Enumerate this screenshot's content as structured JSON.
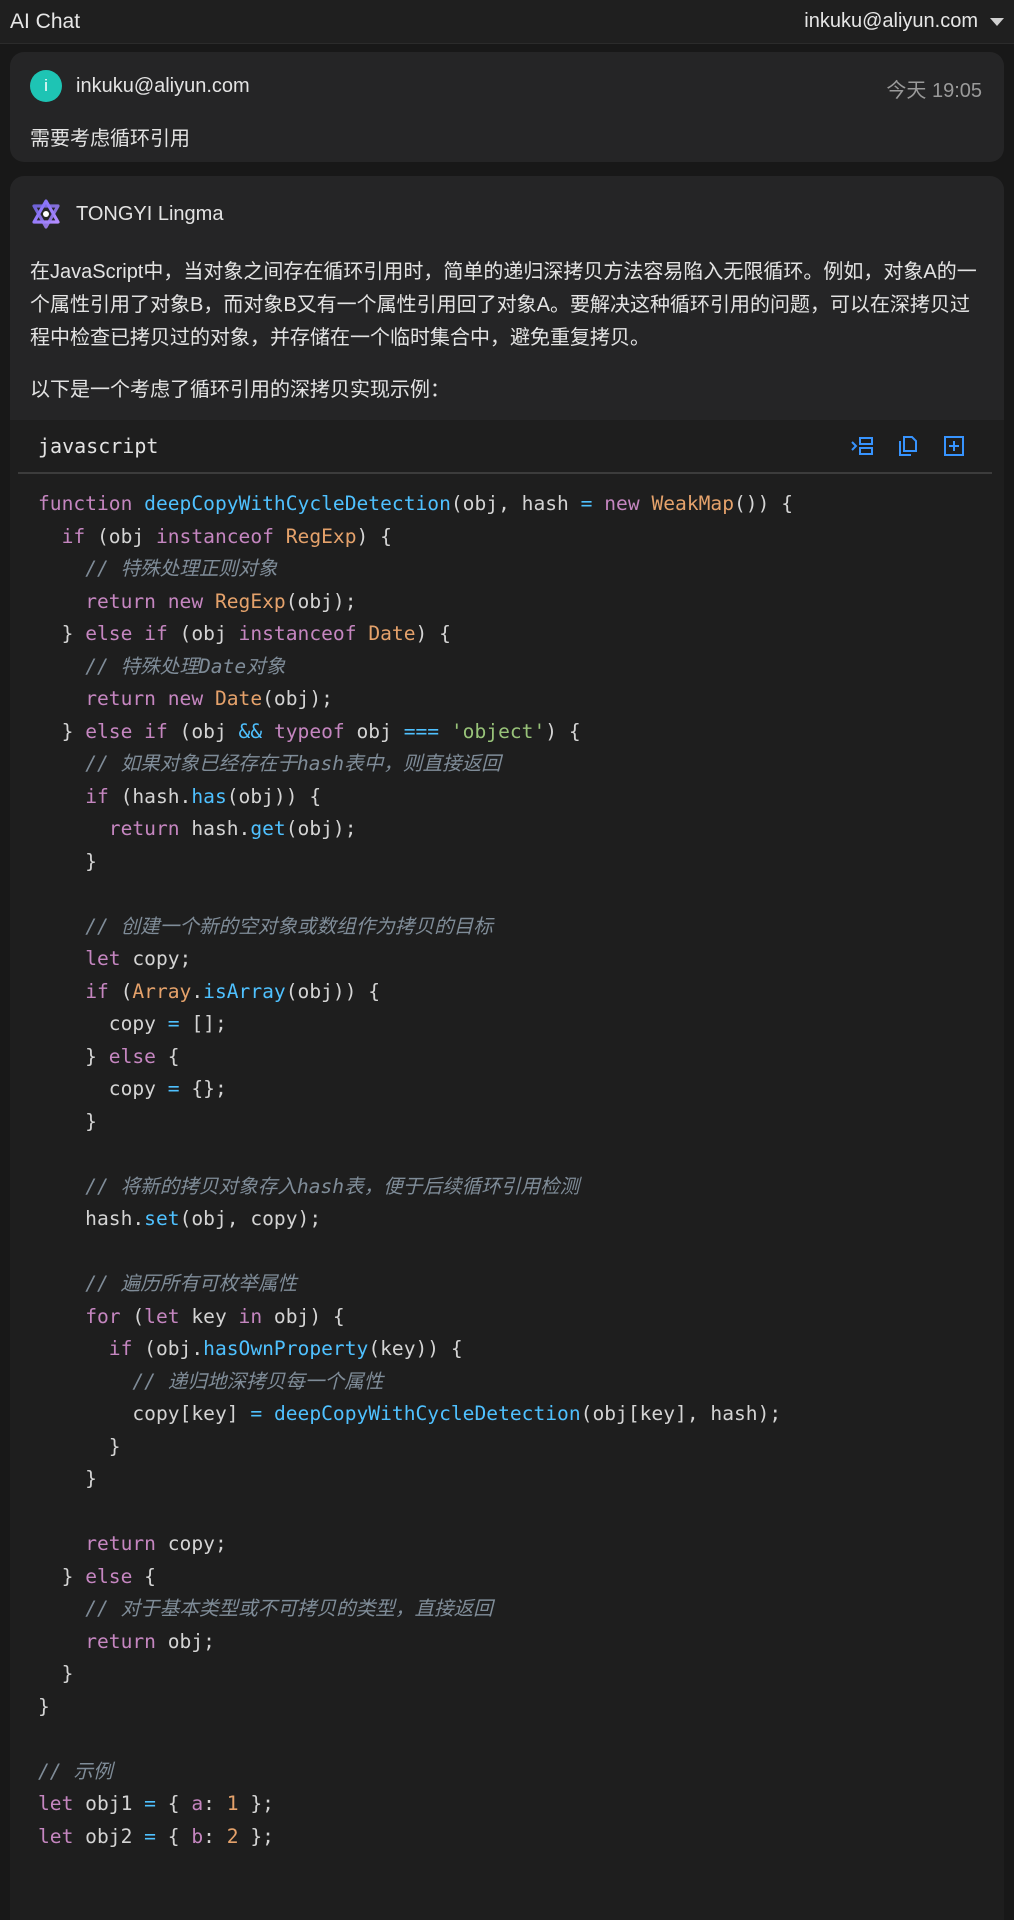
{
  "header": {
    "title": "AI Chat",
    "account": "inkuku@aliyun.com"
  },
  "user_message": {
    "avatar_letter": "i",
    "name": "inkuku@aliyun.com",
    "time": "今天 19:05",
    "text": "需要考虑循环引用"
  },
  "assistant_message": {
    "name": "TONGYI Lingma",
    "paragraph1": "在JavaScript中，当对象之间存在循环引用时，简单的递归深拷贝方法容易陷入无限循环。例如，对象A的一个属性引用了对象B，而对象B又有一个属性引用回了对象A。要解决这种循环引用的问题，可以在深拷贝过程中检查已拷贝过的对象，并存储在一个临时集合中，避免重复拷贝。",
    "paragraph2": "以下是一个考虑了循环引用的深拷贝实现示例：",
    "code_language": "javascript",
    "code_actions": [
      {
        "name": "insert-icon"
      },
      {
        "name": "copy-icon"
      },
      {
        "name": "new-file-icon"
      }
    ],
    "code_lines": [
      [
        [
          "k",
          "function "
        ],
        [
          "f",
          "deepCopyWithCycleDetection"
        ],
        [
          "p",
          "(obj, hash "
        ],
        [
          "f",
          "="
        ],
        [
          "p",
          " "
        ],
        [
          "k",
          "new "
        ],
        [
          "t",
          "WeakMap"
        ],
        [
          "p",
          "()) {"
        ]
      ],
      [
        [
          "p",
          "  "
        ],
        [
          "k",
          "if"
        ],
        [
          "p",
          " (obj "
        ],
        [
          "k",
          "instanceof "
        ],
        [
          "t",
          "RegExp"
        ],
        [
          "p",
          ") {"
        ]
      ],
      [
        [
          "p",
          "    "
        ],
        [
          "c",
          "// 特殊处理正则对象"
        ]
      ],
      [
        [
          "p",
          "    "
        ],
        [
          "k",
          "return "
        ],
        [
          "k",
          "new "
        ],
        [
          "t",
          "RegExp"
        ],
        [
          "p",
          "(obj);"
        ]
      ],
      [
        [
          "p",
          "  } "
        ],
        [
          "k",
          "else if"
        ],
        [
          "p",
          " (obj "
        ],
        [
          "k",
          "instanceof "
        ],
        [
          "t",
          "Date"
        ],
        [
          "p",
          ") {"
        ]
      ],
      [
        [
          "p",
          "    "
        ],
        [
          "c",
          "// 特殊处理Date对象"
        ]
      ],
      [
        [
          "p",
          "    "
        ],
        [
          "k",
          "return "
        ],
        [
          "k",
          "new "
        ],
        [
          "t",
          "Date"
        ],
        [
          "p",
          "(obj);"
        ]
      ],
      [
        [
          "p",
          "  } "
        ],
        [
          "k",
          "else if"
        ],
        [
          "p",
          " (obj "
        ],
        [
          "f",
          "&&"
        ],
        [
          "p",
          " "
        ],
        [
          "k",
          "typeof"
        ],
        [
          "p",
          " obj "
        ],
        [
          "f",
          "==="
        ],
        [
          "p",
          " "
        ],
        [
          "s",
          "'object'"
        ],
        [
          "p",
          ") {"
        ]
      ],
      [
        [
          "p",
          "    "
        ],
        [
          "c",
          "// 如果对象已经存在于hash表中，则直接返回"
        ]
      ],
      [
        [
          "p",
          "    "
        ],
        [
          "k",
          "if"
        ],
        [
          "p",
          " (hash."
        ],
        [
          "f",
          "has"
        ],
        [
          "p",
          "(obj)) {"
        ]
      ],
      [
        [
          "p",
          "      "
        ],
        [
          "k",
          "return"
        ],
        [
          "p",
          " hash."
        ],
        [
          "f",
          "get"
        ],
        [
          "p",
          "(obj);"
        ]
      ],
      [
        [
          "p",
          "    }"
        ]
      ],
      [
        [
          "p",
          ""
        ]
      ],
      [
        [
          "p",
          "    "
        ],
        [
          "c",
          "// 创建一个新的空对象或数组作为拷贝的目标"
        ]
      ],
      [
        [
          "p",
          "    "
        ],
        [
          "k",
          "let"
        ],
        [
          "p",
          " copy;"
        ]
      ],
      [
        [
          "p",
          "    "
        ],
        [
          "k",
          "if"
        ],
        [
          "p",
          " ("
        ],
        [
          "t",
          "Array"
        ],
        [
          "p",
          "."
        ],
        [
          "f",
          "isArray"
        ],
        [
          "p",
          "(obj)) {"
        ]
      ],
      [
        [
          "p",
          "      copy "
        ],
        [
          "f",
          "="
        ],
        [
          "p",
          " [];"
        ]
      ],
      [
        [
          "p",
          "    } "
        ],
        [
          "k",
          "else"
        ],
        [
          "p",
          " {"
        ]
      ],
      [
        [
          "p",
          "      copy "
        ],
        [
          "f",
          "="
        ],
        [
          "p",
          " {};"
        ]
      ],
      [
        [
          "p",
          "    }"
        ]
      ],
      [
        [
          "p",
          ""
        ]
      ],
      [
        [
          "p",
          "    "
        ],
        [
          "c",
          "// 将新的拷贝对象存入hash表，便于后续循环引用检测"
        ]
      ],
      [
        [
          "p",
          "    hash."
        ],
        [
          "f",
          "set"
        ],
        [
          "p",
          "(obj, copy);"
        ]
      ],
      [
        [
          "p",
          ""
        ]
      ],
      [
        [
          "p",
          "    "
        ],
        [
          "c",
          "// 遍历所有可枚举属性"
        ]
      ],
      [
        [
          "p",
          "    "
        ],
        [
          "k",
          "for"
        ],
        [
          "p",
          " ("
        ],
        [
          "k",
          "let"
        ],
        [
          "p",
          " key "
        ],
        [
          "k",
          "in"
        ],
        [
          "p",
          " obj) {"
        ]
      ],
      [
        [
          "p",
          "      "
        ],
        [
          "k",
          "if"
        ],
        [
          "p",
          " (obj."
        ],
        [
          "f",
          "hasOwnProperty"
        ],
        [
          "p",
          "(key)) {"
        ]
      ],
      [
        [
          "p",
          "        "
        ],
        [
          "c",
          "// 递归地深拷贝每一个属性"
        ]
      ],
      [
        [
          "p",
          "        copy[key] "
        ],
        [
          "f",
          "="
        ],
        [
          "p",
          " "
        ],
        [
          "f",
          "deepCopyWithCycleDetection"
        ],
        [
          "p",
          "(obj[key], hash);"
        ]
      ],
      [
        [
          "p",
          "      }"
        ]
      ],
      [
        [
          "p",
          "    }"
        ]
      ],
      [
        [
          "p",
          ""
        ]
      ],
      [
        [
          "p",
          "    "
        ],
        [
          "k",
          "return"
        ],
        [
          "p",
          " copy;"
        ]
      ],
      [
        [
          "p",
          "  } "
        ],
        [
          "k",
          "else"
        ],
        [
          "p",
          " {"
        ]
      ],
      [
        [
          "p",
          "    "
        ],
        [
          "c",
          "// 对于基本类型或不可拷贝的类型，直接返回"
        ]
      ],
      [
        [
          "p",
          "    "
        ],
        [
          "k",
          "return"
        ],
        [
          "p",
          " obj;"
        ]
      ],
      [
        [
          "p",
          "  }"
        ]
      ],
      [
        [
          "p",
          "}"
        ]
      ],
      [
        [
          "p",
          ""
        ]
      ],
      [
        [
          "c",
          "// 示例"
        ]
      ],
      [
        [
          "k",
          "let"
        ],
        [
          "p",
          " obj1 "
        ],
        [
          "f",
          "="
        ],
        [
          "p",
          " { "
        ],
        [
          "kd",
          "a"
        ],
        [
          "p",
          ": "
        ],
        [
          "n",
          "1"
        ],
        [
          "p",
          " };"
        ]
      ],
      [
        [
          "k",
          "let"
        ],
        [
          "p",
          " obj2 "
        ],
        [
          "f",
          "="
        ],
        [
          "p",
          " { "
        ],
        [
          "kd",
          "b"
        ],
        [
          "p",
          ": "
        ],
        [
          "n",
          "2"
        ],
        [
          "p",
          " };"
        ]
      ]
    ]
  }
}
